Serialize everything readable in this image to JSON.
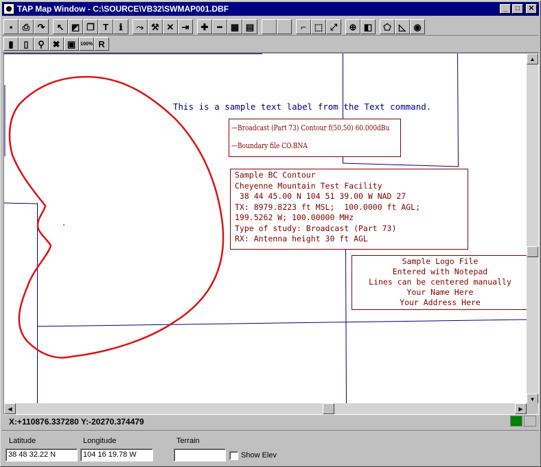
{
  "window": {
    "title": "TAP Map Window - C:\\SOURCE\\VB32\\SWMAP001.DBF",
    "min_glyph": "_",
    "max_glyph": "□",
    "close_glyph": "✕"
  },
  "toolbar1": [
    {
      "name": "save-icon",
      "glyph": "▪"
    },
    {
      "name": "print-icon",
      "glyph": "⎙"
    },
    {
      "name": "redo-icon",
      "glyph": "↷"
    },
    {
      "name": "pointer-icon",
      "glyph": "↖"
    },
    {
      "name": "select-object-icon",
      "glyph": "◩"
    },
    {
      "name": "copy-icon",
      "glyph": "❐"
    },
    {
      "name": "text-icon",
      "glyph": "T"
    },
    {
      "name": "info-icon",
      "glyph": "ℹ"
    },
    {
      "name": "move-icon",
      "glyph": "⤳"
    },
    {
      "name": "tools-icon",
      "glyph": "⚒"
    },
    {
      "name": "delete-icon",
      "glyph": "✕"
    },
    {
      "name": "exit-icon",
      "glyph": "⇥"
    },
    {
      "name": "add-icon",
      "glyph": "✚"
    },
    {
      "name": "ruler-icon",
      "glyph": "┅"
    },
    {
      "name": "grid-icon",
      "glyph": "▦"
    },
    {
      "name": "notepad-icon",
      "glyph": "▤"
    },
    {
      "name": "blank-icon",
      "glyph": ""
    },
    {
      "name": "blank-icon",
      "glyph": ""
    },
    {
      "name": "crop-icon",
      "glyph": "⌐"
    },
    {
      "name": "zoom-window-icon",
      "glyph": "⬚"
    },
    {
      "name": "expand-icon",
      "glyph": "⤢"
    },
    {
      "name": "crosshair-icon",
      "glyph": "⊕"
    },
    {
      "name": "layers-icon",
      "glyph": "◧"
    },
    {
      "name": "polygon-icon",
      "glyph": "⬠"
    },
    {
      "name": "chart-icon",
      "glyph": "◺"
    },
    {
      "name": "color-wheel-icon",
      "glyph": "◉"
    }
  ],
  "toolbar2": [
    {
      "name": "map-green-icon",
      "glyph": "▮"
    },
    {
      "name": "map-small-icon",
      "glyph": "▯"
    },
    {
      "name": "magnify-icon",
      "glyph": "⚲"
    },
    {
      "name": "cancel-icon",
      "glyph": "✖"
    },
    {
      "name": "picture-icon",
      "glyph": "▣"
    },
    {
      "name": "zoom-100-icon",
      "glyph": "100%"
    },
    {
      "name": "reset-icon",
      "glyph": "R"
    }
  ],
  "map": {
    "sample_label": "This is a sample text label from the Text command.",
    "legend": [
      "—Broadcast (Part 73) Contour f(50,50)  60.000dBu",
      "—Boundary file CO.BNA"
    ],
    "study_lines": [
      "Sample BC Contour",
      "Cheyenne Mountain Test Facility",
      " 38 44 45.00 N 104 51 39.00 W NAD 27",
      "TX: 8979.8223 ft MSL;  100.0000 ft AGL;",
      "199.5262 W; 100.00000 MHz",
      "Type of study: Broadcast (Part 73)",
      "RX: Antenna height 30 ft AGL"
    ],
    "logo_lines": [
      "Sample Logo File",
      "Entered with Notepad",
      "Lines can be centered manually",
      "Your Name Here",
      "Your Address Here"
    ],
    "contour_color": "#e01010",
    "boundary_color": "#000080"
  },
  "status": {
    "coords": "X:+110876.337280 Y:-20270.374479"
  },
  "fields": {
    "latitude_label": "Latitude",
    "latitude_value": "38 48 32.22 N",
    "longitude_label": "Longitude",
    "longitude_value": "104 16 19.78 W",
    "terrain_label": "Terrain",
    "terrain_value": "",
    "show_elev_label": "Show Elev"
  }
}
